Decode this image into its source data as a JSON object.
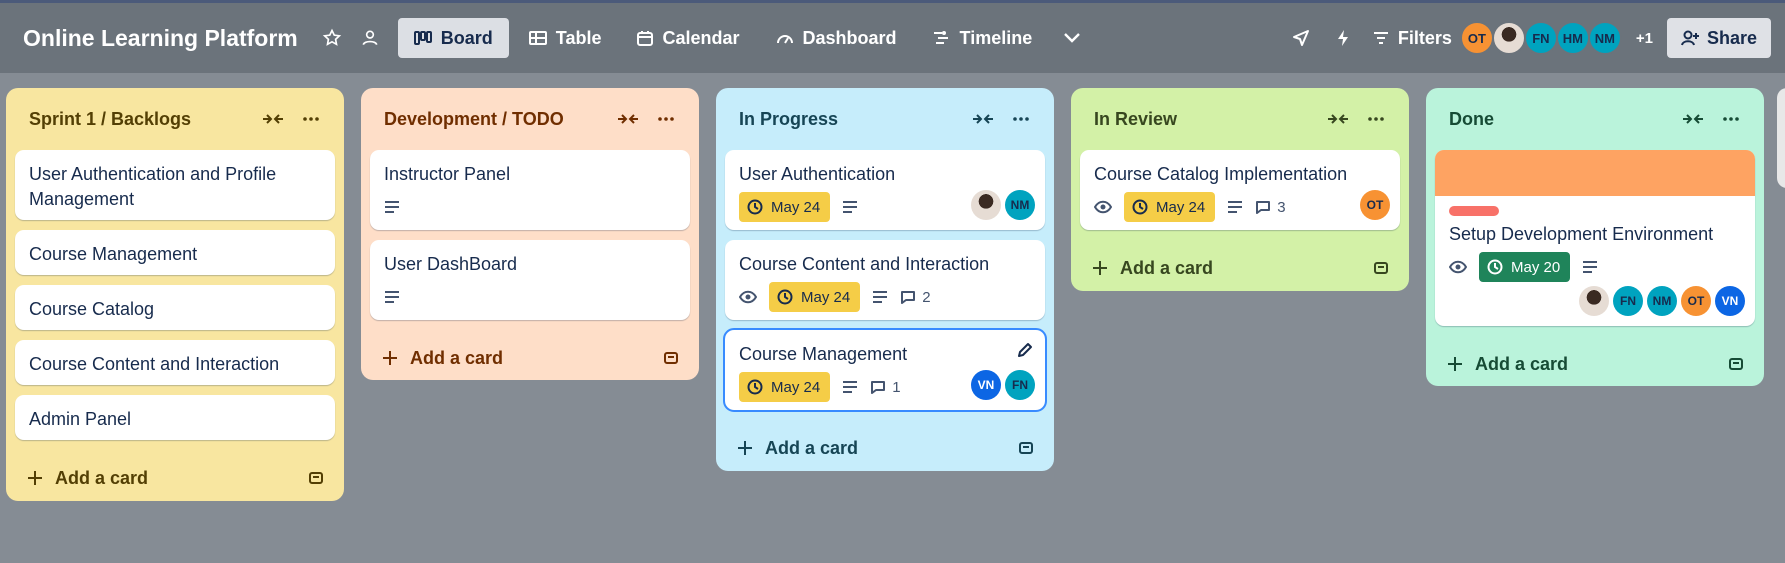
{
  "header": {
    "board_title": "Online Learning Platform",
    "views": [
      {
        "label": "Board",
        "active": true
      },
      {
        "label": "Table"
      },
      {
        "label": "Calendar"
      },
      {
        "label": "Dashboard"
      },
      {
        "label": "Timeline"
      }
    ],
    "filters_label": "Filters",
    "members": [
      {
        "initials": "OT",
        "color": "#f79233"
      },
      {
        "initials": "",
        "photo": true
      },
      {
        "initials": "FN",
        "color": "#00a3bf"
      },
      {
        "initials": "HM",
        "color": "#00a3bf"
      },
      {
        "initials": "NM",
        "color": "#00a3bf"
      }
    ],
    "more_members": "+1",
    "share_label": "Share"
  },
  "lists": [
    {
      "title": "Sprint 1 / Backlogs",
      "bg": "#f8e6a0",
      "fg": "#533f04",
      "cards": [
        {
          "title": "User Authentication and Profile Management"
        },
        {
          "title": "Course Management"
        },
        {
          "title": "Course Catalog"
        },
        {
          "title": "Course Content and Interaction"
        },
        {
          "title": "Admin Panel"
        }
      ],
      "add_label": "Add a card"
    },
    {
      "title": "Development / TODO",
      "bg": "#fedec8",
      "fg": "#702e00",
      "cards": [
        {
          "title": "Instructor Panel"
        },
        {
          "title": "User DashBoard"
        }
      ],
      "add_label": "Add a card"
    },
    {
      "title": "In Progress",
      "bg": "#c6edfb",
      "fg": "#164555",
      "cards": [
        {
          "title": "User Authentication",
          "due": "May 24"
        },
        {
          "title": "Course Content and Interaction",
          "due": "May 24",
          "comments": "2"
        },
        {
          "title": "Course Management",
          "due": "May 24",
          "comments": "1"
        }
      ],
      "add_label": "Add a card"
    },
    {
      "title": "In Review",
      "bg": "#d3f1a7",
      "fg": "#37471f",
      "cards": [
        {
          "title": "Course Catalog Implementation",
          "due": "May 24",
          "comments": "3"
        }
      ],
      "add_label": "Add a card"
    },
    {
      "title": "Done",
      "bg": "#baf3db",
      "fg": "#164b35",
      "cards": [
        {
          "title": "Setup Development Environment",
          "due": "May 20"
        }
      ],
      "add_label": "Add a card"
    }
  ],
  "card_members": {
    "user_auth": [
      {
        "photo": true
      },
      {
        "initials": "NM",
        "color": "#00a3bf"
      }
    ],
    "course_mgmt": [
      {
        "initials": "VN",
        "color": "#0c66e4"
      },
      {
        "initials": "FN",
        "color": "#00a3bf"
      }
    ],
    "catalog_impl": [
      {
        "initials": "OT",
        "color": "#f79233"
      }
    ],
    "setup_env": [
      {
        "photo": true
      },
      {
        "initials": "FN",
        "color": "#00a3bf"
      },
      {
        "initials": "NM",
        "color": "#00a3bf"
      },
      {
        "initials": "OT",
        "color": "#f79233"
      },
      {
        "initials": "VN",
        "color": "#0c66e4"
      }
    ]
  }
}
